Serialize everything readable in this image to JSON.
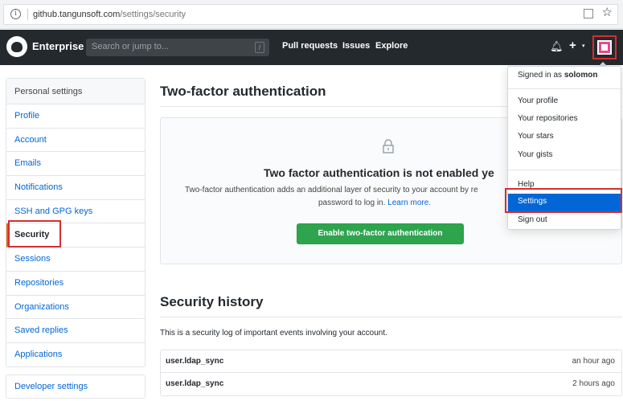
{
  "browser": {
    "url_host": "github.tangunsoft.com",
    "url_path": "/settings/security"
  },
  "header": {
    "brand": "Enterprise",
    "search_placeholder": "Search or jump to...",
    "search_key": "/",
    "nav": [
      "Pull requests",
      "Issues",
      "Explore"
    ],
    "plus": "+",
    "caret": "▾"
  },
  "sidebar": {
    "heading": "Personal settings",
    "items": [
      {
        "label": "Profile"
      },
      {
        "label": "Account"
      },
      {
        "label": "Emails"
      },
      {
        "label": "Notifications"
      },
      {
        "label": "SSH and GPG keys"
      },
      {
        "label": "Security",
        "active": true
      },
      {
        "label": "Sessions"
      },
      {
        "label": "Repositories"
      },
      {
        "label": "Organizations"
      },
      {
        "label": "Saved replies"
      },
      {
        "label": "Applications"
      }
    ],
    "developer_settings": "Developer settings"
  },
  "main": {
    "title": "Two-factor authentication",
    "blankslate_title": "Two factor authentication is not enabled ye",
    "blankslate_line1": "Two-factor authentication adds an additional layer of security to your account by re",
    "blankslate_line2": "password to log in.",
    "learn_more": "Learn more.",
    "enable_button": "Enable two-factor authentication",
    "history_title": "Security history",
    "history_desc": "This is a security log of important events involving your account.",
    "history_rows": [
      {
        "action": "user.ldap_sync",
        "time": "an hour ago"
      },
      {
        "action": "user.ldap_sync",
        "time": "2 hours ago"
      }
    ]
  },
  "dropdown": {
    "signed_in_prefix": "Signed in as",
    "username": "solomon",
    "items": [
      {
        "label": "Your profile"
      },
      {
        "label": "Your repositories"
      },
      {
        "label": "Your stars"
      },
      {
        "label": "Your gists"
      },
      {
        "label": "Help"
      },
      {
        "label": "Settings",
        "active": true
      },
      {
        "label": "Sign out"
      }
    ]
  },
  "colors": {
    "header_bg": "#24292e",
    "link": "#0366d6",
    "primary_button": "#2ea44f",
    "highlight_box": "#d32f2f",
    "active_menu": "#0366d6"
  },
  "icons": [
    "info-icon",
    "github-logo-icon",
    "bell-icon",
    "plus-icon",
    "avatar",
    "lock-icon",
    "bookmark-icon",
    "star-icon"
  ]
}
